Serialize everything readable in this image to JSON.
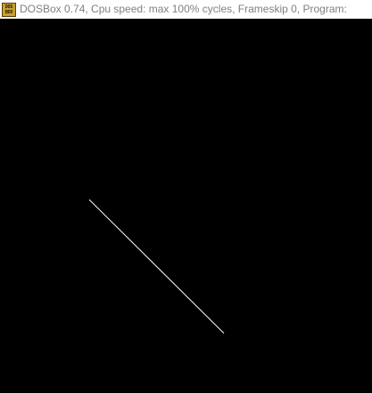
{
  "window": {
    "title": "DOSBox 0.74, Cpu speed: max 100% cycles, Frameskip  0, Program:",
    "icon": {
      "name": "dosbox-icon",
      "line1": "DOS",
      "line2": "BOX",
      "color": "#c8a12a"
    }
  },
  "screen": {
    "background": "#000000",
    "line_color": "#ffffff"
  }
}
